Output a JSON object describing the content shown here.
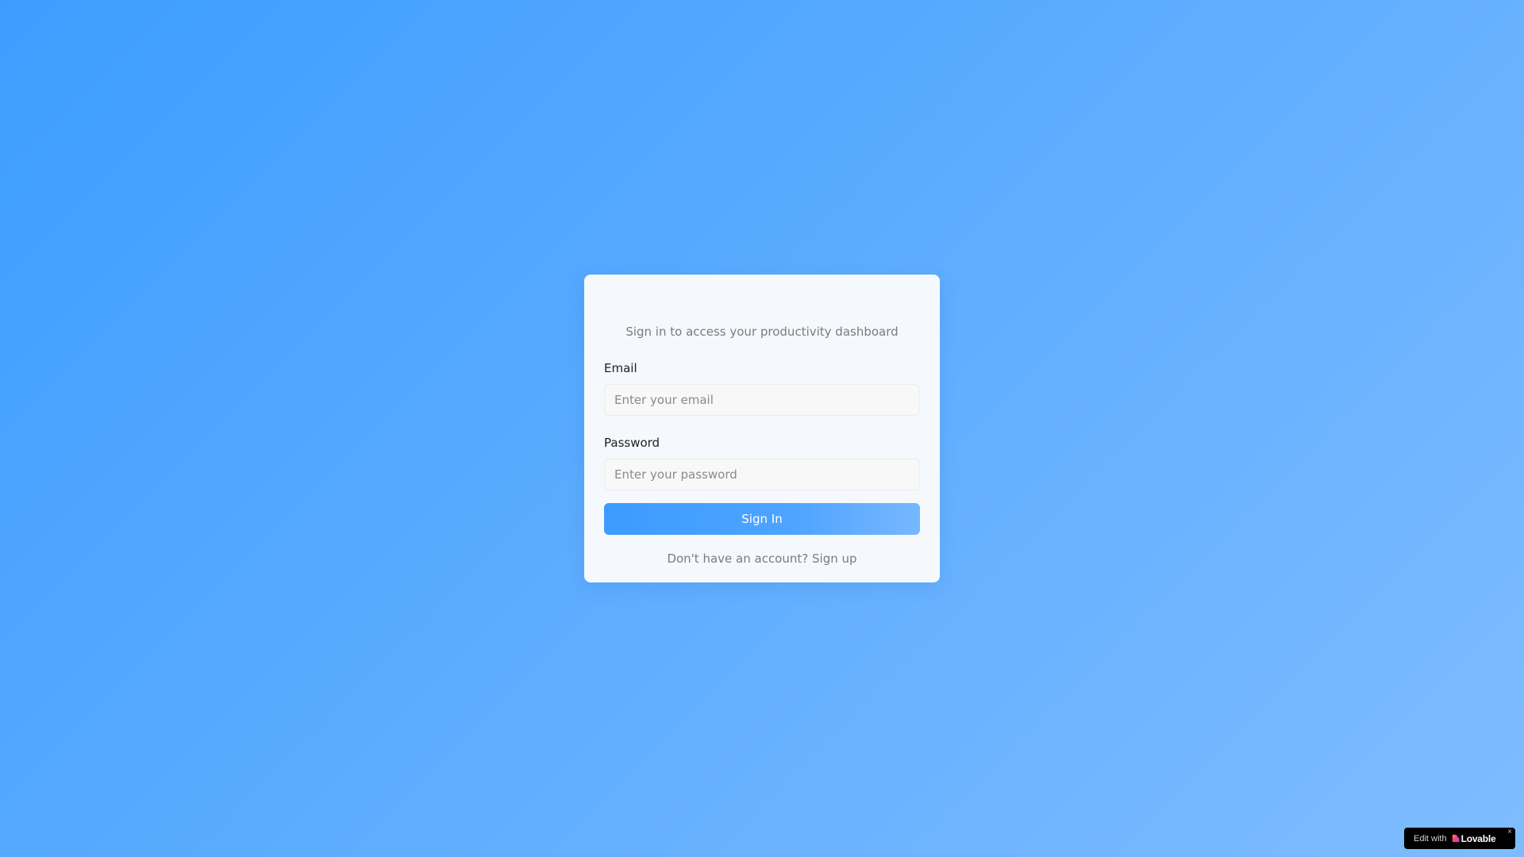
{
  "login": {
    "subtitle": "Sign in to access your productivity dashboard",
    "email": {
      "label": "Email",
      "value": "",
      "placeholder": "Enter your email"
    },
    "password": {
      "label": "Password",
      "value": "",
      "placeholder": "Enter your password"
    },
    "submit_label": "Sign In",
    "signup_prompt": "Don't have an account?",
    "signup_link": "Sign up"
  },
  "badge": {
    "prefix": "Edit with",
    "brand": "Lovable",
    "close_glyph": "×",
    "icon": "heart-icon"
  },
  "colors": {
    "background_start": "#3d9dff",
    "background_end": "#7fbcff",
    "card": "#f5f9fd",
    "button_start": "#3d9bff",
    "button_end": "#77b8ff",
    "muted_text": "#7b7b7b"
  }
}
